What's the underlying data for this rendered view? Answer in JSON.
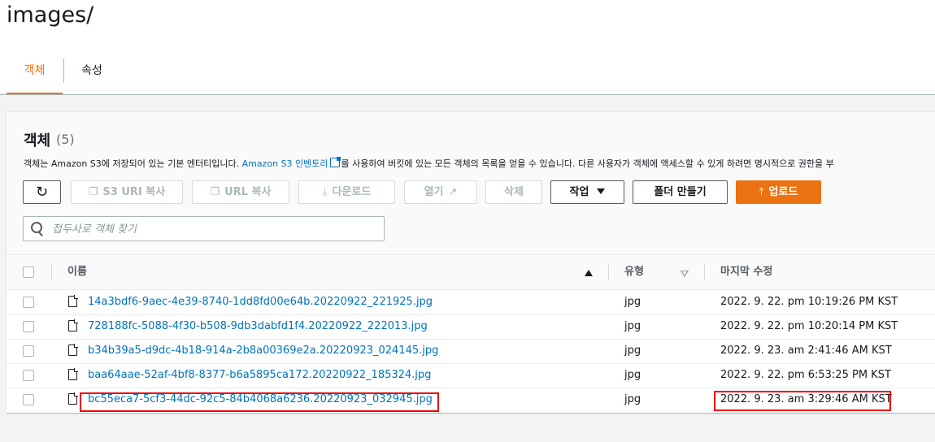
{
  "header": {
    "title": "images/"
  },
  "tabs": [
    {
      "label": "객체"
    },
    {
      "label": "속성"
    }
  ],
  "panel": {
    "title": "객체",
    "count": "(5)",
    "description_pre": "객체는 Amazon S3에 저장되어 있는 기본 엔터티입니다. ",
    "description_link": "Amazon S3 인벤토리",
    "description_post": "를 사용하여 버킷에 있는 모든 객체의 목록을 얻을 수 있습니다. 다른 사용자가 객체에 액세스할 수 있게 하려면 명시적으로 권한을 부"
  },
  "toolbar": {
    "s3_uri_copy": "S3 URI 복사",
    "url_copy": "URL 복사",
    "download": "다운로드",
    "open": "열기",
    "delete": "삭제",
    "actions": "작업",
    "create_folder": "폴더 만들기",
    "upload": "업로드"
  },
  "search": {
    "placeholder": "접두사로 객체 찾기"
  },
  "table": {
    "columns": {
      "name": "이름",
      "type": "유형",
      "modified": "마지막 수정"
    },
    "rows": [
      {
        "name": "14a3bdf6-9aec-4e39-8740-1dd8fd00e64b.20220922_221925.jpg",
        "type": "jpg",
        "modified": "2022. 9. 22. pm 10:19:26 PM KST"
      },
      {
        "name": "728188fc-5088-4f30-b508-9db3dabfd1f4.20220922_222013.jpg",
        "type": "jpg",
        "modified": "2022. 9. 22. pm 10:20:14 PM KST"
      },
      {
        "name": "b34b39a5-d9dc-4b18-914a-2b8a00369e2a.20220923_024145.jpg",
        "type": "jpg",
        "modified": "2022. 9. 23. am 2:41:46 AM KST"
      },
      {
        "name": "baa64aae-52af-4bf8-8377-b6a5895ca172.20220922_185324.jpg",
        "type": "jpg",
        "modified": "2022. 9. 22. pm 6:53:25 PM KST"
      },
      {
        "name": "bc55eca7-5cf3-44dc-92c5-84b4068a6236.20220923_032945.jpg",
        "type": "jpg",
        "modified": "2022. 9. 23. am 3:29:46 AM KST"
      }
    ]
  },
  "icons": {
    "refresh": "refresh-icon",
    "copy": "copy-icon",
    "download": "download-icon",
    "external": "external-link-icon",
    "caret": "caret-down-icon",
    "upload": "upload-icon",
    "search": "search-icon",
    "file": "file-icon"
  },
  "colors": {
    "accent": "#ec7211",
    "link": "#0073bb",
    "highlight": "#e00000"
  }
}
